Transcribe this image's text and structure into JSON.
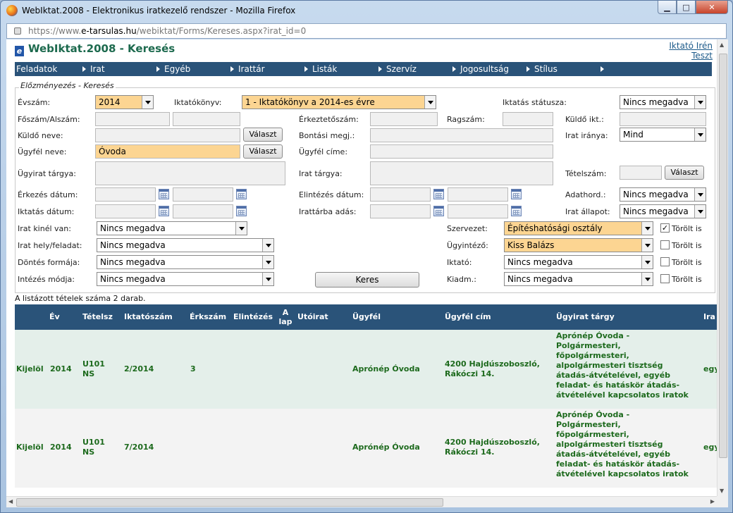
{
  "window": {
    "title": "WebIktat.2008 - Elektronikus iratkezelő rendszer - Mozilla Firefox",
    "url_prefix": "https://www.",
    "url_domain": "e-tarsulas.hu",
    "url_path": "/webiktat/Forms/Kereses.aspx?irat_id=0"
  },
  "header": {
    "title": "WebIktat.2008 - Keresés",
    "user": "Iktató Irén",
    "role": "Teszt"
  },
  "menu": [
    "Feladatok",
    "Irat",
    "Egyéb",
    "Irattár",
    "Listák",
    "Szervíz",
    "Jogosultság",
    "Stílus"
  ],
  "search": {
    "legend": "Előzményezés - Keresés",
    "labels": {
      "evszam": "Évszám:",
      "iktatokonyv": "Iktatókönyv:",
      "iktatas_statusza": "Iktatás státusza:",
      "foszam": "Főszám/Alszám:",
      "erkezteto": "Érkeztetőszám:",
      "ragszam": "Ragszám:",
      "kuldo_ikt": "Küldő ikt.:",
      "kuldo_neve": "Küldő neve:",
      "bontasi": "Bontási megj.:",
      "irat_iranya": "Irat iránya:",
      "ugyfel_neve": "Ügyfél neve:",
      "ugyfel_cime": "Ügyfél címe:",
      "ugyirat_targya": "Ügyirat tárgya:",
      "irat_targya": "Irat tárgya:",
      "tetelszam": "Tételszám:",
      "erkezes_datum": "Érkezés dátum:",
      "elintezes_datum": "Elintézés dátum:",
      "adathord": "Adathord.:",
      "iktatas_datum": "Iktatás dátum:",
      "irattarba": "Irattárba adás:",
      "irat_allapot": "Irat állapot:",
      "irat_kinel": "Irat kinél van:",
      "szervezet": "Szervezet:",
      "irat_hely": "Irat hely/feladat:",
      "ugyintezo": "Ügyintéző:",
      "dontes": "Döntés formája:",
      "iktato": "Iktató:",
      "intezes": "Intézés módja:",
      "kiadm": "Kiadm.:",
      "torolt": "Törölt is"
    },
    "values": {
      "evszam": "2014",
      "iktatokonyv": "1 - Iktatókönyv a 2014-es évre",
      "iktatas_statusza": "Nincs megadva",
      "irat_iranya": "Mind",
      "ugyfel_neve": "Óvoda",
      "adathord": "Nincs megadva",
      "irat_allapot": "Nincs megadva",
      "irat_kinel": "Nincs megadva",
      "szervezet": "Építéshatósági osztály",
      "irat_hely": "Nincs megadva",
      "ugyintezo": "Kiss Balázs",
      "dontes": "Nincs megadva",
      "iktato": "Nincs megadva",
      "intezes": "Nincs megadva",
      "kiadm": "Nincs megadva"
    },
    "checkboxes": {
      "szervezet_torolt": true,
      "ugyintezo_torolt": false,
      "iktato_torolt": false,
      "kiadm_torolt": false
    },
    "valaszt_label": "Választ",
    "keres_label": "Keres",
    "check_glyph": "✓"
  },
  "results": {
    "count_text": "A listázott tételek száma 2 darab.",
    "headers": [
      "Év",
      "Tételsz",
      "Iktatószám",
      "Érkszám",
      "Elintézés",
      "A lap",
      "Utóirat",
      "Ügyfél",
      "Ügyfél cím",
      "Ügyirat tárgy",
      "Ira"
    ],
    "rows": [
      {
        "action": "Kijelöl",
        "ev": "2014",
        "tetel1": "U101",
        "tetel2": "NS",
        "iktatoszam": "2/2014",
        "erkszam": "3",
        "ugyfel": "Aprónép Óvoda",
        "cim1": "4200 Hajdúszoboszló,",
        "cim2": "Rákóczi 14.",
        "targy": [
          "Aprónép Óvoda -",
          "Polgármesteri,",
          "főpolgármesteri,",
          "alpolgármesteri tisztség",
          "átadás-átvételével, egyéb",
          "feladat- és hatáskör átadás-",
          "átvételével kapcsolatos iratok"
        ],
        "extra": "egy"
      },
      {
        "action": "Kijelöl",
        "ev": "2014",
        "tetel1": "U101",
        "tetel2": "NS",
        "iktatoszam": "7/2014",
        "erkszam": "",
        "ugyfel": "Aprónép Óvoda",
        "cim1": "4200 Hajdúszoboszló,",
        "cim2": "Rákóczi 14.",
        "targy": [
          "Aprónép Óvoda -",
          "Polgármesteri,",
          "főpolgármesteri,",
          "alpolgármesteri tisztség",
          "átadás-átvételével, egyéb",
          "feladat- és hatáskör átadás-",
          "átvételével kapcsolatos iratok"
        ],
        "extra": "egy"
      }
    ]
  }
}
